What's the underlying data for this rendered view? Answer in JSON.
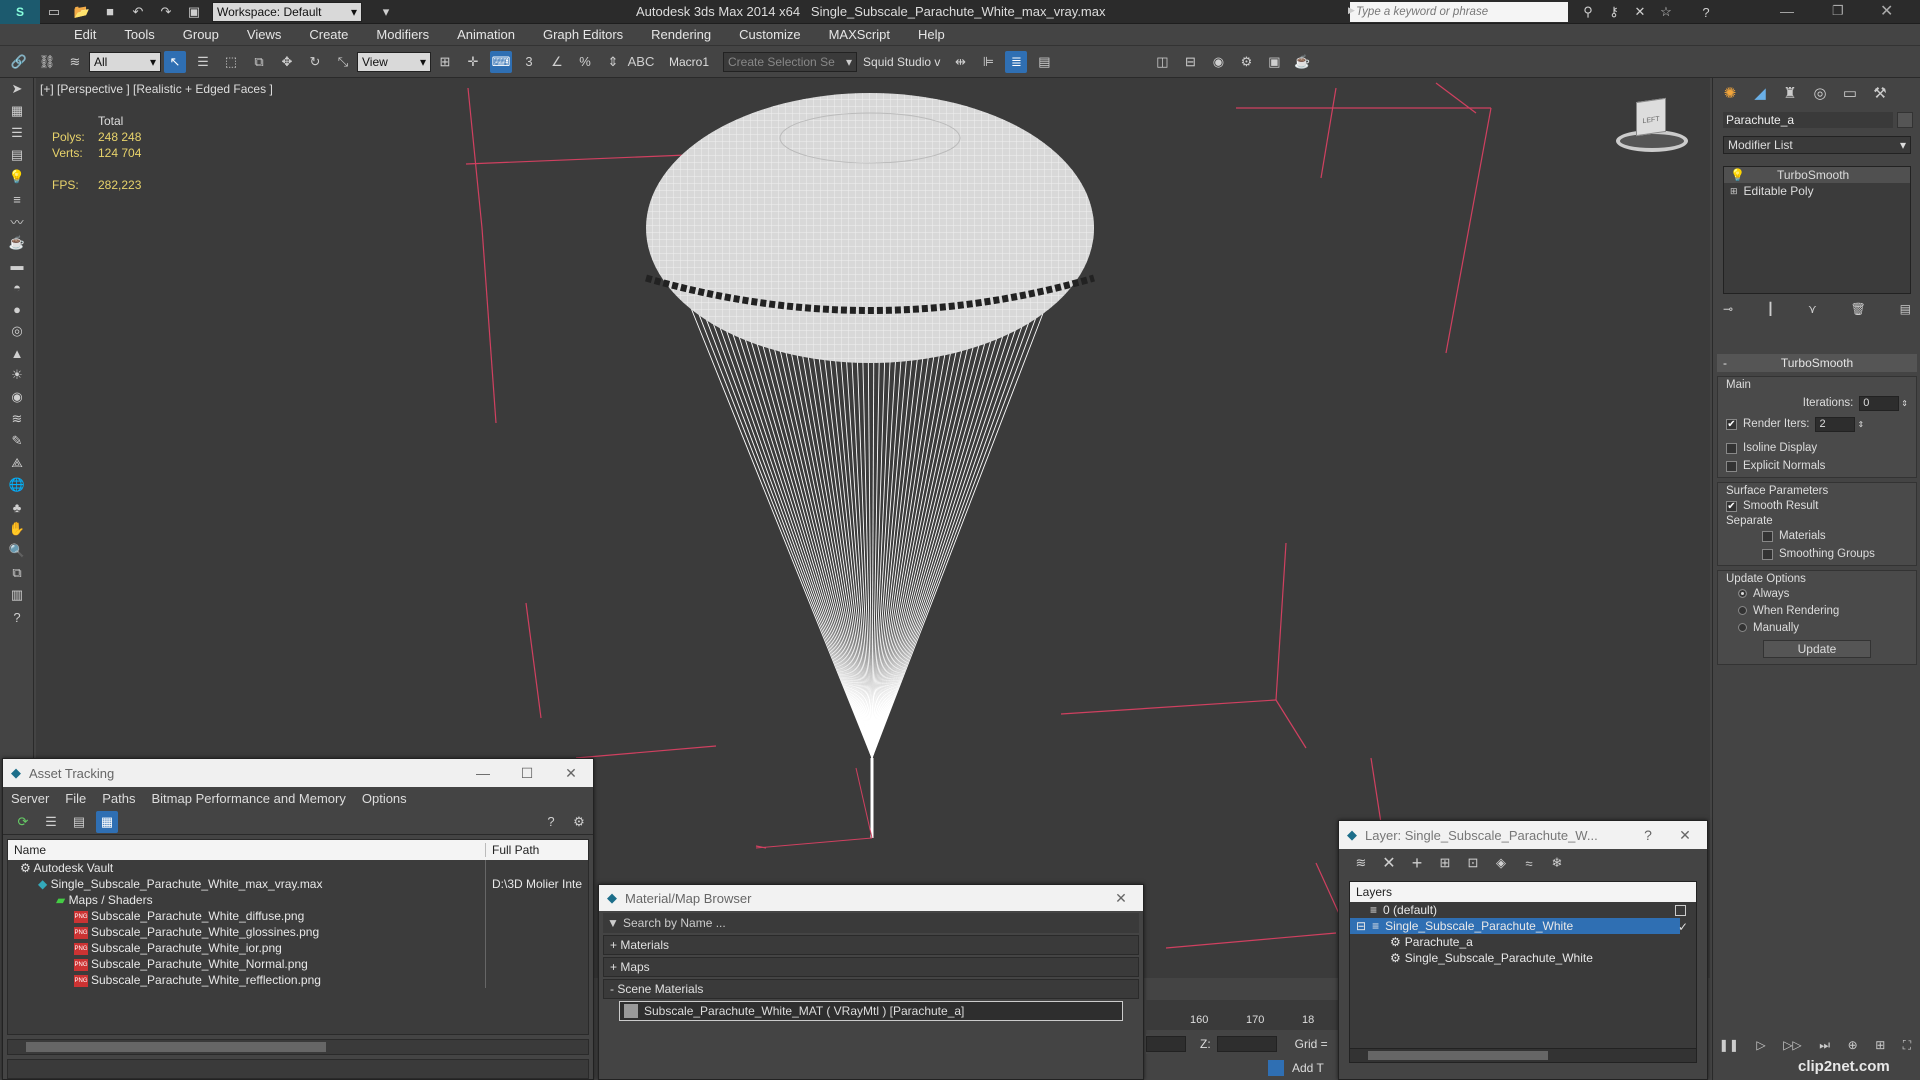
{
  "titlebar": {
    "workspace": "Workspace: Default",
    "app_title": "Autodesk 3ds Max  2014 x64",
    "file_title": "Single_Subscale_Parachute_White_max_vray.max",
    "search_placeholder": "Type a keyword or phrase"
  },
  "menu": [
    "Edit",
    "Tools",
    "Group",
    "Views",
    "Create",
    "Modifiers",
    "Animation",
    "Graph Editors",
    "Rendering",
    "Customize",
    "MAXScript",
    "Help"
  ],
  "toolbar": {
    "filter": "All",
    "refcoord": "View",
    "macro": "Macro1",
    "selection_set": "Create Selection Se",
    "squid": "Squid Studio v"
  },
  "viewport": {
    "label": "[+] [Perspective ] [Realistic + Edged Faces ]",
    "stats": {
      "total_label": "Total",
      "polys_label": "Polys:",
      "polys_value": "248 248",
      "verts_label": "Verts:",
      "verts_value": "124 704",
      "fps_label": "FPS:",
      "fps_value": "282,223"
    },
    "viewcube_label": "LEFT"
  },
  "right_panel": {
    "object_name": "Parachute_a",
    "modifier_list": "Modifier List",
    "stack": [
      "TurboSmooth",
      "Editable Poly"
    ],
    "turbosmooth": {
      "title": "TurboSmooth",
      "main_label": "Main",
      "iterations_label": "Iterations:",
      "iterations_value": "0",
      "render_iters_label": "Render Iters:",
      "render_iters_value": "2",
      "isoline_label": "Isoline Display",
      "explicit_label": "Explicit Normals",
      "surface_label": "Surface Parameters",
      "smooth_result_label": "Smooth Result",
      "separate_label": "Separate",
      "materials_label": "Materials",
      "smoothing_groups_label": "Smoothing Groups",
      "update_options_label": "Update Options",
      "always_label": "Always",
      "when_rendering_label": "When Rendering",
      "manually_label": "Manually",
      "update_button": "Update"
    }
  },
  "asset_tracking": {
    "title": "Asset Tracking",
    "menu": [
      "Server",
      "File",
      "Paths",
      "Bitmap Performance and Memory",
      "Options"
    ],
    "col_name": "Name",
    "col_path": "Full Path",
    "rows": [
      {
        "name": "Autodesk Vault",
        "path": "",
        "indent": 0
      },
      {
        "name": "Single_Subscale_Parachute_White_max_vray.max",
        "path": "D:\\3D Molier Inte",
        "indent": 1
      },
      {
        "name": "Maps / Shaders",
        "path": "",
        "indent": 2
      },
      {
        "name": "Subscale_Parachute_White_diffuse.png",
        "path": "",
        "indent": 3
      },
      {
        "name": "Subscale_Parachute_White_glossines.png",
        "path": "",
        "indent": 3
      },
      {
        "name": "Subscale_Parachute_White_ior.png",
        "path": "",
        "indent": 3
      },
      {
        "name": "Subscale_Parachute_White_Normal.png",
        "path": "",
        "indent": 3
      },
      {
        "name": "Subscale_Parachute_White_refflection.png",
        "path": "",
        "indent": 3
      }
    ]
  },
  "material_browser": {
    "title": "Material/Map Browser",
    "search_placeholder": "Search by Name ...",
    "sections": [
      "+ Materials",
      "+ Maps",
      "- Scene Materials"
    ],
    "material": "Subscale_Parachute_White_MAT  ( VRayMtl )  [Parachute_a]"
  },
  "layer_window": {
    "title": "Layer: Single_Subscale_Parachute_W...",
    "header": "Layers",
    "rows": [
      "0 (default)",
      "Single_Subscale_Parachute_White",
      "Parachute_a",
      "Single_Subscale_Parachute_White"
    ]
  },
  "timeline": {
    "ticks": [
      "160",
      "170",
      "18"
    ],
    "z_label": "Z:",
    "grid_label": "Grid =",
    "add_label": "Add T"
  },
  "watermark": "clip2net.com"
}
